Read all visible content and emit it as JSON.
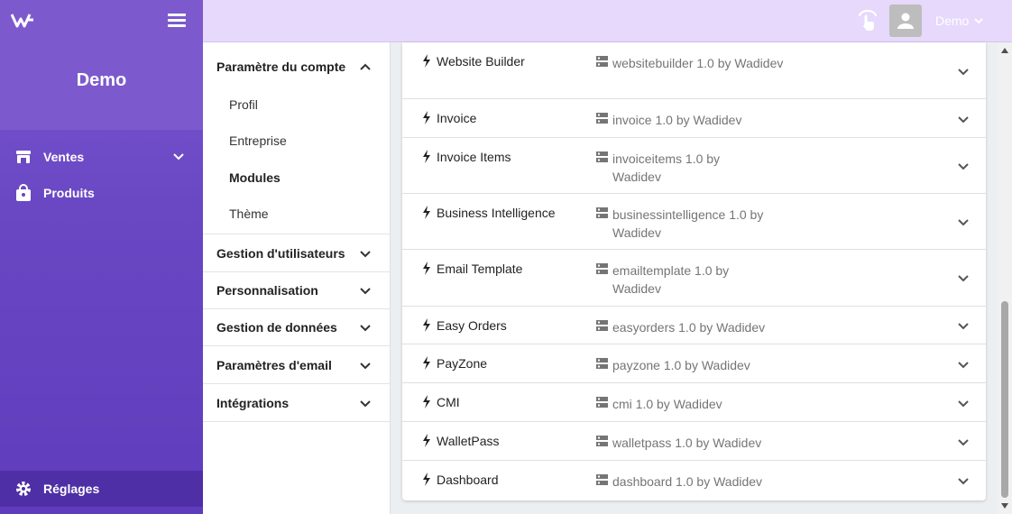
{
  "sidebar": {
    "brand": "Demo",
    "items": [
      {
        "label": "Ventes",
        "icon": "store-icon"
      },
      {
        "label": "Produits",
        "icon": "shopping-bag-icon"
      }
    ],
    "bottom": {
      "label": "Réglages",
      "icon": "gear-icon"
    }
  },
  "header": {
    "user": "Demo"
  },
  "settings_nav": {
    "sections": [
      {
        "label": "Paramètre du compte",
        "expanded": true,
        "items": [
          "Profil",
          "Entreprise",
          "Modules",
          "Thème"
        ],
        "active": "Modules"
      },
      {
        "label": "Gestion d'utilisateurs"
      },
      {
        "label": "Personnalisation"
      },
      {
        "label": "Gestion de données"
      },
      {
        "label": "Paramètres d'email"
      },
      {
        "label": "Intégrations"
      }
    ]
  },
  "modules": [
    {
      "name": "Website Builder",
      "package": "websitebuilder 1.0 by Wadidev"
    },
    {
      "name": "Invoice",
      "package": "invoice 1.0 by Wadidev"
    },
    {
      "name": "Invoice Items",
      "package": "invoiceitems 1.0 by Wadidev"
    },
    {
      "name": "Business Intelligence",
      "package": "businessintelligence 1.0 by Wadidev"
    },
    {
      "name": "Email Template",
      "package": "emailtemplate 1.0 by Wadidev"
    },
    {
      "name": "Easy Orders",
      "package": "easyorders 1.0 by Wadidev"
    },
    {
      "name": "PayZone",
      "package": "payzone 1.0 by Wadidev"
    },
    {
      "name": "CMI",
      "package": "cmi 1.0 by Wadidev"
    },
    {
      "name": "WalletPass",
      "package": "walletpass 1.0 by Wadidev"
    },
    {
      "name": "Dashboard",
      "package": "dashboard 1.0 by Wadidev"
    }
  ],
  "colors": {
    "sidebar": "#6a48c4",
    "sidebar_active": "#4f2fa6",
    "header": "#e6d9fb"
  }
}
